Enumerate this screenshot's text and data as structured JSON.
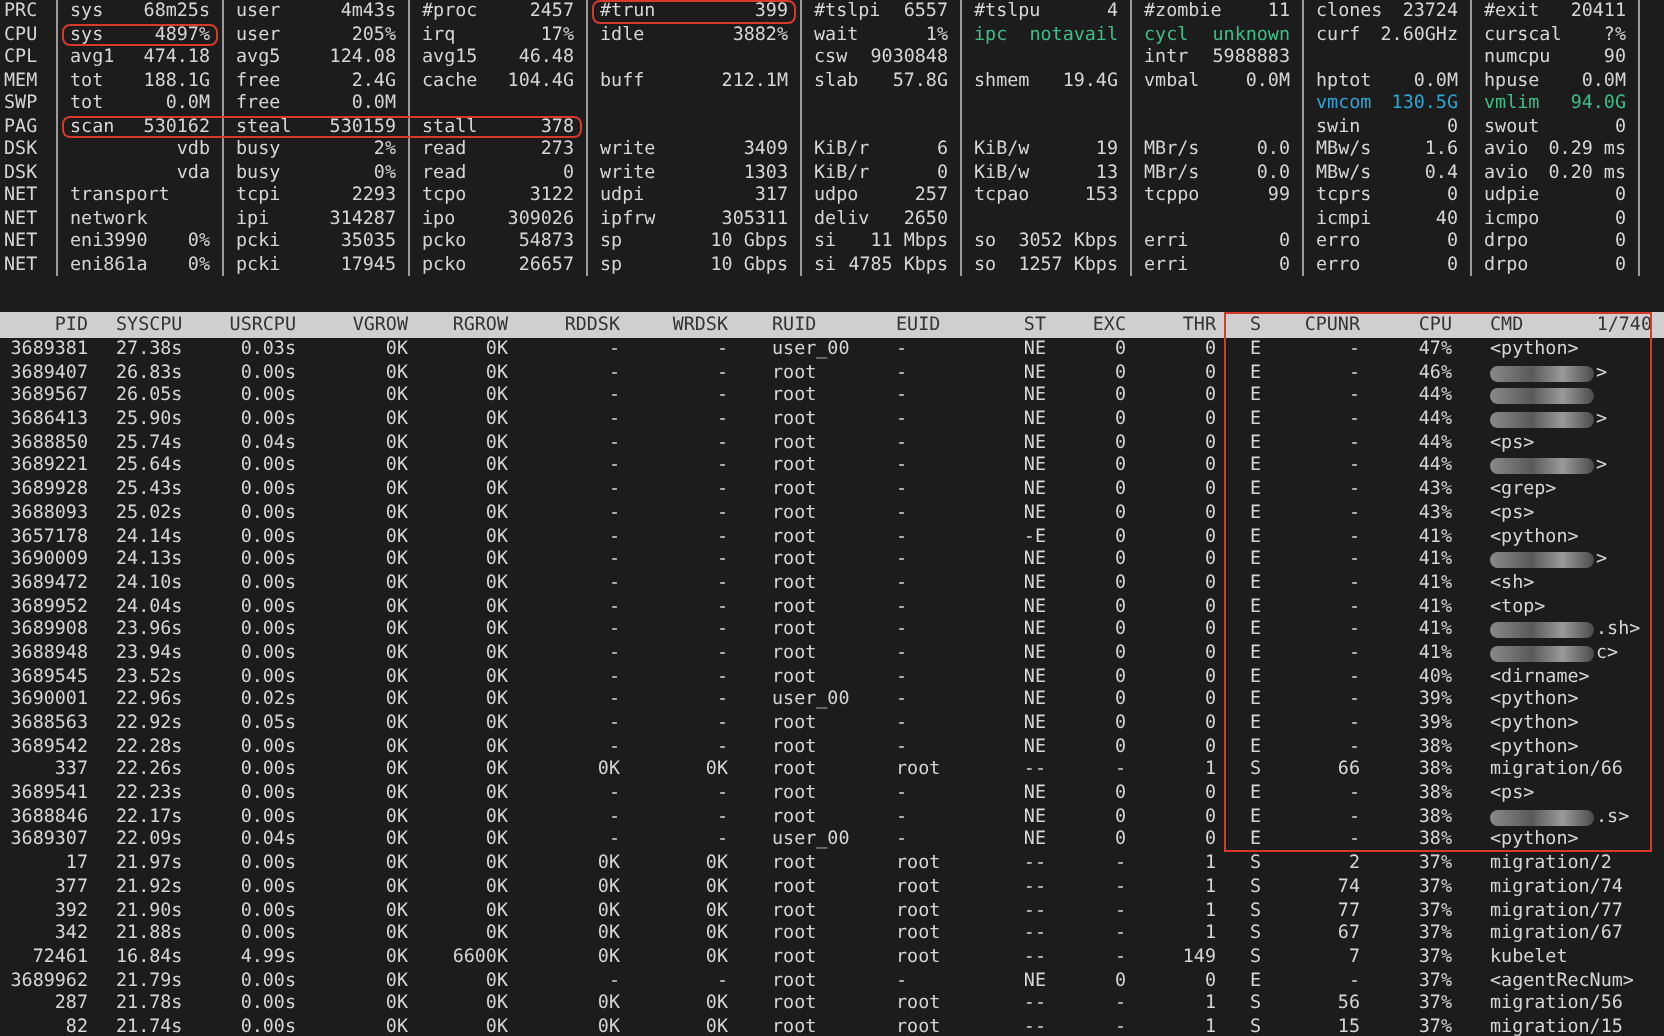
{
  "summary": {
    "rows": [
      {
        "label": "PRC",
        "cells": [
          {
            "key": "sys",
            "value": "68m25s",
            "highlighted": false
          },
          {
            "key": "user",
            "value": "4m43s",
            "highlighted": false
          },
          {
            "key": "#proc",
            "value": "2457",
            "highlighted": false
          },
          {
            "key": "#trun",
            "value": "399",
            "highlighted": true
          },
          {
            "key": "#tslpi",
            "value": "6557",
            "highlighted": false
          },
          {
            "key": "#tslpu",
            "value": "4",
            "highlighted": false
          },
          {
            "key": "#zombie",
            "value": "11",
            "highlighted": false
          },
          {
            "key": "clones",
            "value": "23724",
            "highlighted": false
          },
          {
            "key": "#exit",
            "value": "20411",
            "highlighted": false
          }
        ]
      },
      {
        "label": "CPU",
        "cells": [
          {
            "key": "sys",
            "value": "4897%",
            "highlighted": true
          },
          {
            "key": "user",
            "value": "205%",
            "highlighted": false
          },
          {
            "key": "irq",
            "value": "17%",
            "highlighted": false
          },
          {
            "key": "idle",
            "value": "3882%",
            "highlighted": false
          },
          {
            "key": "wait",
            "value": "1%",
            "highlighted": false
          },
          {
            "key": "ipc",
            "value": "notavail",
            "highlighted": false,
            "color": "#3fbf86"
          },
          {
            "key": "cycl",
            "value": "unknown",
            "highlighted": false,
            "color": "#3fbf86"
          },
          {
            "key": "curf",
            "value": "2.60GHz",
            "highlighted": false
          },
          {
            "key": "curscal",
            "value": "?%",
            "highlighted": false
          }
        ]
      },
      {
        "label": "CPL",
        "cells": [
          {
            "key": "avg1",
            "value": "474.18",
            "highlighted": false
          },
          {
            "key": "avg5",
            "value": "124.08",
            "highlighted": false
          },
          {
            "key": "avg15",
            "value": "46.48",
            "highlighted": false
          },
          {
            "highlighted": false
          },
          {
            "key": "csw",
            "value": "9030848",
            "highlighted": false
          },
          {
            "highlighted": false
          },
          {
            "key": "intr",
            "value": "5988883",
            "highlighted": false
          },
          {
            "highlighted": false
          },
          {
            "key": "numcpu",
            "value": "90",
            "highlighted": false
          }
        ]
      },
      {
        "label": "MEM",
        "cells": [
          {
            "key": "tot",
            "value": "188.1G",
            "highlighted": false
          },
          {
            "key": "free",
            "value": "2.4G",
            "highlighted": false
          },
          {
            "key": "cache",
            "value": "104.4G",
            "highlighted": false
          },
          {
            "key": "buff",
            "value": "212.1M",
            "highlighted": false
          },
          {
            "key": "slab",
            "value": "57.8G",
            "highlighted": false
          },
          {
            "key": "shmem",
            "value": "19.4G",
            "highlighted": false
          },
          {
            "key": "vmbal",
            "value": "0.0M",
            "highlighted": false
          },
          {
            "key": "hptot",
            "value": "0.0M",
            "highlighted": false
          },
          {
            "key": "hpuse",
            "value": "0.0M",
            "highlighted": false
          }
        ]
      },
      {
        "label": "SWP",
        "cells": [
          {
            "key": "tot",
            "value": "0.0M",
            "highlighted": false
          },
          {
            "key": "free",
            "value": "0.0M",
            "highlighted": false
          },
          {
            "highlighted": false
          },
          {
            "highlighted": false
          },
          {
            "highlighted": false
          },
          {
            "highlighted": false
          },
          {
            "highlighted": false
          },
          {
            "key": "vmcom",
            "value": "130.5G",
            "highlighted": false,
            "color": "#2fa6d6"
          },
          {
            "key": "vmlim",
            "value": "94.0G",
            "highlighted": false,
            "color": "#3fbf86"
          }
        ]
      },
      {
        "label": "PAG",
        "cells": [
          {
            "key": "scan",
            "value": "530162",
            "highlighted": true
          },
          {
            "key": "steal",
            "value": "530159",
            "highlighted": true
          },
          {
            "key": "stall",
            "value": "378",
            "highlighted": true
          },
          {
            "highlighted": false
          },
          {
            "highlighted": false
          },
          {
            "highlighted": false
          },
          {
            "highlighted": false
          },
          {
            "key": "swin",
            "value": "0",
            "highlighted": false
          },
          {
            "key": "swout",
            "value": "0",
            "highlighted": false
          }
        ]
      },
      {
        "label": "DSK",
        "cells": [
          {
            "value": "vdb",
            "highlighted": false
          },
          {
            "key": "busy",
            "value": "2%",
            "highlighted": false
          },
          {
            "key": "read",
            "value": "273",
            "highlighted": false
          },
          {
            "key": "write",
            "value": "3409",
            "highlighted": false
          },
          {
            "key": "KiB/r",
            "value": "6",
            "highlighted": false
          },
          {
            "key": "KiB/w",
            "value": "19",
            "highlighted": false
          },
          {
            "key": "MBr/s",
            "value": "0.0",
            "highlighted": false
          },
          {
            "key": "MBw/s",
            "value": "1.6",
            "highlighted": false
          },
          {
            "key": "avio",
            "value": "0.29 ms",
            "highlighted": false
          }
        ]
      },
      {
        "label": "DSK",
        "cells": [
          {
            "value": "vda",
            "highlighted": false
          },
          {
            "key": "busy",
            "value": "0%",
            "highlighted": false
          },
          {
            "key": "read",
            "value": "0",
            "highlighted": false
          },
          {
            "key": "write",
            "value": "1303",
            "highlighted": false
          },
          {
            "key": "KiB/r",
            "value": "0",
            "highlighted": false
          },
          {
            "key": "KiB/w",
            "value": "13",
            "highlighted": false
          },
          {
            "key": "MBr/s",
            "value": "0.0",
            "highlighted": false
          },
          {
            "key": "MBw/s",
            "value": "0.4",
            "highlighted": false
          },
          {
            "key": "avio",
            "value": "0.20 ms",
            "highlighted": false
          }
        ]
      },
      {
        "label": "NET",
        "cells": [
          {
            "key": "transport",
            "highlighted": false
          },
          {
            "key": "tcpi",
            "value": "2293",
            "highlighted": false
          },
          {
            "key": "tcpo",
            "value": "3122",
            "highlighted": false
          },
          {
            "key": "udpi",
            "value": "317",
            "highlighted": false
          },
          {
            "key": "udpo",
            "value": "257",
            "highlighted": false
          },
          {
            "key": "tcpao",
            "value": "153",
            "highlighted": false
          },
          {
            "key": "tcppo",
            "value": "99",
            "highlighted": false
          },
          {
            "key": "tcprs",
            "value": "0",
            "highlighted": false
          },
          {
            "key": "udpie",
            "value": "0",
            "highlighted": false
          }
        ]
      },
      {
        "label": "NET",
        "cells": [
          {
            "key": "network",
            "highlighted": false
          },
          {
            "key": "ipi",
            "value": "314287",
            "highlighted": false
          },
          {
            "key": "ipo",
            "value": "309026",
            "highlighted": false
          },
          {
            "key": "ipfrw",
            "value": "305311",
            "highlighted": false
          },
          {
            "key": "deliv",
            "value": "2650",
            "highlighted": false
          },
          {
            "highlighted": false
          },
          {
            "highlighted": false
          },
          {
            "key": "icmpi",
            "value": "40",
            "highlighted": false
          },
          {
            "key": "icmpo",
            "value": "0",
            "highlighted": false
          }
        ]
      },
      {
        "label": "NET",
        "cells": [
          {
            "key": "eni3990",
            "value": "0%",
            "highlighted": false
          },
          {
            "key": "pcki",
            "value": "35035",
            "highlighted": false
          },
          {
            "key": "pcko",
            "value": "54873",
            "highlighted": false
          },
          {
            "key": "sp",
            "value": "10 Gbps",
            "highlighted": false
          },
          {
            "key": "si",
            "value": "11 Mbps",
            "highlighted": false
          },
          {
            "key": "so",
            "value": "3052 Kbps",
            "highlighted": false
          },
          {
            "key": "erri",
            "value": "0",
            "highlighted": false
          },
          {
            "key": "erro",
            "value": "0",
            "highlighted": false
          },
          {
            "key": "drpo",
            "value": "0",
            "highlighted": false
          }
        ]
      },
      {
        "label": "NET",
        "cells": [
          {
            "key": "eni861a",
            "value": "0%",
            "highlighted": false
          },
          {
            "key": "pcki",
            "value": "17945",
            "highlighted": false
          },
          {
            "key": "pcko",
            "value": "26657",
            "highlighted": false
          },
          {
            "key": "sp",
            "value": "10 Gbps",
            "highlighted": false
          },
          {
            "key": "si",
            "value": "4785 Kbps",
            "highlighted": false
          },
          {
            "key": "so",
            "value": "1257 Kbps",
            "highlighted": false
          },
          {
            "key": "erri",
            "value": "0",
            "highlighted": false
          },
          {
            "key": "erro",
            "value": "0",
            "highlighted": false
          },
          {
            "key": "drpo",
            "value": "0",
            "highlighted": false
          }
        ]
      }
    ]
  },
  "process_table": {
    "columns": [
      "PID",
      "SYSCPU",
      "USRCPU",
      "VGROW",
      "RGROW",
      "RDDSK",
      "WRDSK",
      "RUID",
      "EUID",
      "ST",
      "EXC",
      "THR",
      "S",
      "CPUNR",
      "CPU",
      "CMD"
    ],
    "count": "1/740",
    "header_highlighted": true,
    "rows": [
      {
        "cells": [
          "3689381",
          "27.38s",
          "0.03s",
          "0K",
          "0K",
          "-",
          "-",
          "user_00",
          "-",
          "NE",
          "0",
          "0",
          "E",
          "-",
          "47%"
        ],
        "cmd": "<python>",
        "redacted": false,
        "highlighted": true
      },
      {
        "cells": [
          "3689407",
          "26.83s",
          "0.00s",
          "0K",
          "0K",
          "-",
          "-",
          "root",
          "-",
          "NE",
          "0",
          "0",
          "E",
          "-",
          "46%"
        ],
        "cmd": ">",
        "redacted": true,
        "highlighted": true
      },
      {
        "cells": [
          "3689567",
          "26.05s",
          "0.00s",
          "0K",
          "0K",
          "-",
          "-",
          "root",
          "-",
          "NE",
          "0",
          "0",
          "E",
          "-",
          "44%"
        ],
        "redacted": true,
        "highlighted": true
      },
      {
        "cells": [
          "3686413",
          "25.90s",
          "0.00s",
          "0K",
          "0K",
          "-",
          "-",
          "root",
          "-",
          "NE",
          "0",
          "0",
          "E",
          "-",
          "44%"
        ],
        "cmd": ">",
        "redacted": true,
        "highlighted": true
      },
      {
        "cells": [
          "3688850",
          "25.74s",
          "0.04s",
          "0K",
          "0K",
          "-",
          "-",
          "root",
          "-",
          "NE",
          "0",
          "0",
          "E",
          "-",
          "44%"
        ],
        "cmd": "<ps>",
        "redacted": false,
        "highlighted": true
      },
      {
        "cells": [
          "3689221",
          "25.64s",
          "0.00s",
          "0K",
          "0K",
          "-",
          "-",
          "root",
          "-",
          "NE",
          "0",
          "0",
          "E",
          "-",
          "44%"
        ],
        "cmd": ">",
        "redacted": true,
        "highlighted": true
      },
      {
        "cells": [
          "3689928",
          "25.43s",
          "0.00s",
          "0K",
          "0K",
          "-",
          "-",
          "root",
          "-",
          "NE",
          "0",
          "0",
          "E",
          "-",
          "43%"
        ],
        "cmd": "<grep>",
        "redacted": false,
        "highlighted": true
      },
      {
        "cells": [
          "3688093",
          "25.02s",
          "0.00s",
          "0K",
          "0K",
          "-",
          "-",
          "root",
          "-",
          "NE",
          "0",
          "0",
          "E",
          "-",
          "43%"
        ],
        "cmd": "<ps>",
        "redacted": false,
        "highlighted": true
      },
      {
        "cells": [
          "3657178",
          "24.14s",
          "0.00s",
          "0K",
          "0K",
          "-",
          "-",
          "root",
          "-",
          "-E",
          "0",
          "0",
          "E",
          "-",
          "41%"
        ],
        "cmd": "<python>",
        "redacted": false,
        "highlighted": true
      },
      {
        "cells": [
          "3690009",
          "24.13s",
          "0.00s",
          "0K",
          "0K",
          "-",
          "-",
          "root",
          "-",
          "NE",
          "0",
          "0",
          "E",
          "-",
          "41%"
        ],
        "cmd": ">",
        "redacted": true,
        "highlighted": true
      },
      {
        "cells": [
          "3689472",
          "24.10s",
          "0.00s",
          "0K",
          "0K",
          "-",
          "-",
          "root",
          "-",
          "NE",
          "0",
          "0",
          "E",
          "-",
          "41%"
        ],
        "cmd": "<sh>",
        "redacted": false,
        "highlighted": true
      },
      {
        "cells": [
          "3689952",
          "24.04s",
          "0.00s",
          "0K",
          "0K",
          "-",
          "-",
          "root",
          "-",
          "NE",
          "0",
          "0",
          "E",
          "-",
          "41%"
        ],
        "cmd": "<top>",
        "redacted": false,
        "highlighted": true
      },
      {
        "cells": [
          "3689908",
          "23.96s",
          "0.00s",
          "0K",
          "0K",
          "-",
          "-",
          "root",
          "-",
          "NE",
          "0",
          "0",
          "E",
          "-",
          "41%"
        ],
        "cmd": ".sh>",
        "redacted": true,
        "highlighted": true
      },
      {
        "cells": [
          "3688948",
          "23.94s",
          "0.00s",
          "0K",
          "0K",
          "-",
          "-",
          "root",
          "-",
          "NE",
          "0",
          "0",
          "E",
          "-",
          "41%"
        ],
        "cmd": "c>",
        "redacted": true,
        "highlighted": true
      },
      {
        "cells": [
          "3689545",
          "23.52s",
          "0.00s",
          "0K",
          "0K",
          "-",
          "-",
          "root",
          "-",
          "NE",
          "0",
          "0",
          "E",
          "-",
          "40%"
        ],
        "cmd": "<dirname>",
        "redacted": false,
        "highlighted": true
      },
      {
        "cells": [
          "3690001",
          "22.96s",
          "0.02s",
          "0K",
          "0K",
          "-",
          "-",
          "user_00",
          "-",
          "NE",
          "0",
          "0",
          "E",
          "-",
          "39%"
        ],
        "cmd": "<python>",
        "redacted": false,
        "highlighted": true
      },
      {
        "cells": [
          "3688563",
          "22.92s",
          "0.05s",
          "0K",
          "0K",
          "-",
          "-",
          "root",
          "-",
          "NE",
          "0",
          "0",
          "E",
          "-",
          "39%"
        ],
        "cmd": "<python>",
        "redacted": false,
        "highlighted": true
      },
      {
        "cells": [
          "3689542",
          "22.28s",
          "0.00s",
          "0K",
          "0K",
          "-",
          "-",
          "root",
          "-",
          "NE",
          "0",
          "0",
          "E",
          "-",
          "38%"
        ],
        "cmd": "<python>",
        "redacted": false,
        "highlighted": true
      },
      {
        "cells": [
          "337",
          "22.26s",
          "0.00s",
          "0K",
          "0K",
          "0K",
          "0K",
          "root",
          "root",
          "--",
          "-",
          "1",
          "S",
          "66",
          "38%"
        ],
        "cmd": "migration/66",
        "redacted": false,
        "highlighted": true
      },
      {
        "cells": [
          "3689541",
          "22.23s",
          "0.00s",
          "0K",
          "0K",
          "-",
          "-",
          "root",
          "-",
          "NE",
          "0",
          "0",
          "E",
          "-",
          "38%"
        ],
        "cmd": "<ps>",
        "redacted": false,
        "highlighted": true
      },
      {
        "cells": [
          "3688846",
          "22.17s",
          "0.00s",
          "0K",
          "0K",
          "-",
          "-",
          "root",
          "-",
          "NE",
          "0",
          "0",
          "E",
          "-",
          "38%"
        ],
        "cmd": ".s>",
        "redacted": true,
        "highlighted": true
      },
      {
        "cells": [
          "3689307",
          "22.09s",
          "0.04s",
          "0K",
          "0K",
          "-",
          "-",
          "user_00",
          "-",
          "NE",
          "0",
          "0",
          "E",
          "-",
          "38%"
        ],
        "cmd": "<python>",
        "redacted": false,
        "highlighted": true
      },
      {
        "cells": [
          "17",
          "21.97s",
          "0.00s",
          "0K",
          "0K",
          "0K",
          "0K",
          "root",
          "root",
          "--",
          "-",
          "1",
          "S",
          "2",
          "37%"
        ],
        "cmd": "migration/2",
        "redacted": false,
        "highlighted": false
      },
      {
        "cells": [
          "377",
          "21.92s",
          "0.00s",
          "0K",
          "0K",
          "0K",
          "0K",
          "root",
          "root",
          "--",
          "-",
          "1",
          "S",
          "74",
          "37%"
        ],
        "cmd": "migration/74",
        "redacted": false,
        "highlighted": false
      },
      {
        "cells": [
          "392",
          "21.90s",
          "0.00s",
          "0K",
          "0K",
          "0K",
          "0K",
          "root",
          "root",
          "--",
          "-",
          "1",
          "S",
          "77",
          "37%"
        ],
        "cmd": "migration/77",
        "redacted": false,
        "highlighted": false
      },
      {
        "cells": [
          "342",
          "21.88s",
          "0.00s",
          "0K",
          "0K",
          "0K",
          "0K",
          "root",
          "root",
          "--",
          "-",
          "1",
          "S",
          "67",
          "37%"
        ],
        "cmd": "migration/67",
        "redacted": false,
        "highlighted": false
      },
      {
        "cells": [
          "72461",
          "16.84s",
          "4.99s",
          "0K",
          "6600K",
          "0K",
          "0K",
          "root",
          "root",
          "--",
          "-",
          "149",
          "S",
          "7",
          "37%"
        ],
        "cmd": "kubelet",
        "redacted": false,
        "highlighted": false
      },
      {
        "cells": [
          "3689962",
          "21.79s",
          "0.00s",
          "0K",
          "0K",
          "-",
          "-",
          "root",
          "-",
          "NE",
          "0",
          "0",
          "E",
          "-",
          "37%"
        ],
        "cmd": "<agentRecNum>",
        "redacted": false,
        "highlighted": false
      },
      {
        "cells": [
          "287",
          "21.78s",
          "0.00s",
          "0K",
          "0K",
          "0K",
          "0K",
          "root",
          "root",
          "--",
          "-",
          "1",
          "S",
          "56",
          "37%"
        ],
        "cmd": "migration/56",
        "redacted": false,
        "highlighted": false
      },
      {
        "cells": [
          "82",
          "21.74s",
          "0.00s",
          "0K",
          "0K",
          "0K",
          "0K",
          "root",
          "root",
          "--",
          "-",
          "1",
          "S",
          "15",
          "37%"
        ],
        "cmd": "migration/15",
        "redacted": false,
        "highlighted": false
      }
    ]
  }
}
